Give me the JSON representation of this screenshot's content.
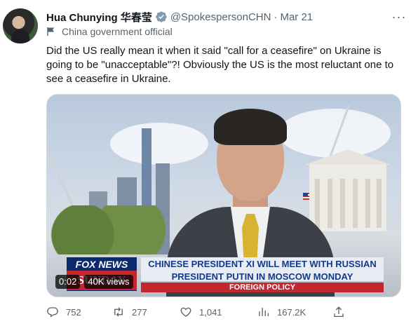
{
  "tweet": {
    "display_name": "Hua Chunying 华春莹",
    "handle": "@SpokespersonCHN",
    "date": "Mar 21",
    "account_label": "China government official",
    "text": "Did the US really mean it when it said \"call for a ceasefire\" on Ukraine is going to be \"unacceptable\"?! Obviously the US is the most reluctant one to see a ceasefire in Ukraine."
  },
  "media": {
    "network_logo_top": "FOX NEWS",
    "network_logo_bottom": "SUNDAY",
    "headline_line1": "CHINESE PRESIDENT XI WILL MEET WITH RUSSIAN",
    "headline_line2": "PRESIDENT PUTIN IN MOSCOW MONDAY",
    "section": "FOREIGN POLICY",
    "elapsed_time": "0:02",
    "views": "40K views"
  },
  "actions": {
    "replies": "752",
    "retweets": "277",
    "likes": "1,041",
    "views": "167.2K"
  },
  "colors": {
    "text_primary": "#0f1419",
    "text_secondary": "#536471",
    "verified_badge": "#829aab",
    "fox_blue": "#0b2a6b",
    "fox_red": "#c1272d"
  },
  "icons": {
    "verified": "verified-badge-icon",
    "more": "more-icon",
    "label": "government-flag-icon",
    "reply": "reply-icon",
    "retweet": "retweet-icon",
    "like": "heart-icon",
    "views": "views-chart-icon",
    "share": "share-icon"
  }
}
